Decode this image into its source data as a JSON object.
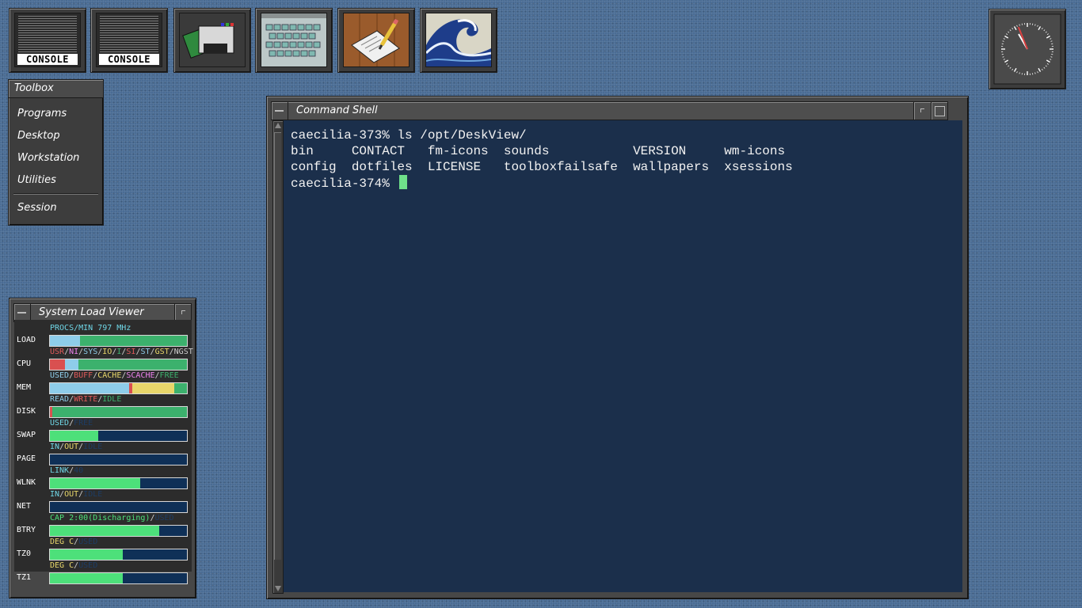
{
  "desktop": {
    "icons": [
      {
        "kind": "console",
        "label": "CONSOLE"
      },
      {
        "kind": "console",
        "label": "CONSOLE"
      },
      {
        "kind": "floppy-icon"
      },
      {
        "kind": "keyboard-icon"
      },
      {
        "kind": "notepad-icon"
      },
      {
        "kind": "wave-icon"
      }
    ]
  },
  "toolbox": {
    "title": "Toolbox",
    "items": [
      "Programs",
      "Desktop",
      "Workstation",
      "Utilities"
    ],
    "session": "Session"
  },
  "terminal": {
    "title": "Command Shell",
    "lines": [
      "caecilia-373% ls /opt/DeskView/",
      "bin     CONTACT   fm-icons  sounds           VERSION     wm-icons",
      "config  dotfiles  LICENSE   toolboxfailsafe  wallpapers  xsessions"
    ],
    "prompt": "caecilia-374% ",
    "colors": {
      "background": "#1b2f4b",
      "text": "#f2f2f2",
      "cursor": "#6fe08a"
    }
  },
  "load_viewer": {
    "title": "System Load Viewer",
    "rows": [
      {
        "name": "LOAD",
        "legend": [
          {
            "t": "PROCS/MIN   797 MHz",
            "c": "#6fd6e6"
          }
        ],
        "segs": [
          {
            "v": 0.22,
            "c": "#8ecdea"
          },
          {
            "v": 0.78,
            "c": "#3cb16d"
          }
        ]
      },
      {
        "name": "CPU",
        "legend": [
          {
            "t": "USR",
            "c": "#e05a5a"
          },
          {
            "t": "/",
            "c": "#ccc"
          },
          {
            "t": "NI",
            "c": "#ee82ee"
          },
          {
            "t": "/",
            "c": "#ccc"
          },
          {
            "t": "SYS",
            "c": "#8ecdea"
          },
          {
            "t": "/",
            "c": "#ccc"
          },
          {
            "t": "IO",
            "c": "#e8d66a"
          },
          {
            "t": "/",
            "c": "#ccc"
          },
          {
            "t": "I",
            "c": "#3cb16d"
          },
          {
            "t": "/",
            "c": "#ccc"
          },
          {
            "t": "SI",
            "c": "#e05a5a"
          },
          {
            "t": "/",
            "c": "#ccc"
          },
          {
            "t": "ST",
            "c": "#8ecdea"
          },
          {
            "t": "/",
            "c": "#ccc"
          },
          {
            "t": "GST",
            "c": "#e8d66a"
          },
          {
            "t": "/",
            "c": "#ccc"
          },
          {
            "t": "NGST",
            "c": "#ccc"
          }
        ],
        "segs": [
          {
            "v": 0.11,
            "c": "#d95050"
          },
          {
            "v": 0.1,
            "c": "#8ecdea"
          },
          {
            "v": 0.79,
            "c": "#3cb16d"
          }
        ]
      },
      {
        "name": "MEM",
        "legend": [
          {
            "t": "USED",
            "c": "#8ecdea"
          },
          {
            "t": "/",
            "c": "#ccc"
          },
          {
            "t": "BUFF",
            "c": "#e05a5a"
          },
          {
            "t": "/",
            "c": "#ccc"
          },
          {
            "t": "CACHE",
            "c": "#e8d66a"
          },
          {
            "t": "/",
            "c": "#ccc"
          },
          {
            "t": "SCACHE",
            "c": "#ee82ee"
          },
          {
            "t": "/",
            "c": "#ccc"
          },
          {
            "t": "FREE",
            "c": "#3cb16d"
          }
        ],
        "segs": [
          {
            "v": 0.58,
            "c": "#8ecdea"
          },
          {
            "v": 0.02,
            "c": "#d95050"
          },
          {
            "v": 0.31,
            "c": "#e8d66a"
          },
          {
            "v": 0.09,
            "c": "#3cb16d"
          }
        ]
      },
      {
        "name": "DISK",
        "legend": [
          {
            "t": "READ",
            "c": "#8ecdea"
          },
          {
            "t": "/",
            "c": "#ccc"
          },
          {
            "t": "WRITE",
            "c": "#e05a5a"
          },
          {
            "t": "/",
            "c": "#ccc"
          },
          {
            "t": "IDLE",
            "c": "#3cb16d"
          }
        ],
        "segs": [
          {
            "v": 0.02,
            "c": "#d95050"
          },
          {
            "v": 0.98,
            "c": "#3cb16d"
          }
        ]
      },
      {
        "name": "SWAP",
        "legend": [
          {
            "t": "USED",
            "c": "#6fd6e6"
          },
          {
            "t": "/",
            "c": "#ccc"
          },
          {
            "t": "FREE",
            "c": "#1d3d66"
          }
        ],
        "segs": [
          {
            "v": 0.35,
            "c": "#4de07a"
          }
        ]
      },
      {
        "name": "PAGE",
        "legend": [
          {
            "t": "IN",
            "c": "#6fd6e6"
          },
          {
            "t": "/",
            "c": "#ccc"
          },
          {
            "t": "OUT",
            "c": "#e8d66a"
          },
          {
            "t": "/",
            "c": "#ccc"
          },
          {
            "t": "IDLE",
            "c": "#1d3d66"
          }
        ],
        "segs": []
      },
      {
        "name": "WLNK",
        "legend": [
          {
            "t": "LINK",
            "c": "#6fd6e6"
          },
          {
            "t": "/",
            "c": "#ccc"
          },
          {
            "t": "40",
            "c": "#1d3d66"
          }
        ],
        "segs": [
          {
            "v": 0.66,
            "c": "#4de07a"
          }
        ]
      },
      {
        "name": "NET",
        "legend": [
          {
            "t": "IN",
            "c": "#6fd6e6"
          },
          {
            "t": "/",
            "c": "#ccc"
          },
          {
            "t": "OUT",
            "c": "#e8d66a"
          },
          {
            "t": "/",
            "c": "#ccc"
          },
          {
            "t": "IDLE",
            "c": "#1d3d66"
          }
        ],
        "segs": []
      },
      {
        "name": "BTRY",
        "legend": [
          {
            "t": "CAP 2:00(Discharging)",
            "c": "#4de07a"
          },
          {
            "t": "/",
            "c": "#ccc"
          },
          {
            "t": "USED",
            "c": "#1d3d66"
          }
        ],
        "segs": [
          {
            "v": 0.8,
            "c": "#4de07a"
          }
        ]
      },
      {
        "name": "TZ0",
        "legend": [
          {
            "t": "DEG C",
            "c": "#e8d66a"
          },
          {
            "t": "/",
            "c": "#ccc"
          },
          {
            "t": "USED",
            "c": "#1d3d66"
          }
        ],
        "segs": [
          {
            "v": 0.53,
            "c": "#4de07a"
          }
        ]
      },
      {
        "name": "TZ1",
        "legend": [
          {
            "t": "DEG C",
            "c": "#e8d66a"
          },
          {
            "t": "/",
            "c": "#ccc"
          },
          {
            "t": "USED",
            "c": "#1d3d66"
          }
        ],
        "segs": [
          {
            "v": 0.53,
            "c": "#4de07a"
          }
        ]
      }
    ]
  },
  "clock": {
    "hour_angle": 330,
    "minute_angle": 338
  }
}
